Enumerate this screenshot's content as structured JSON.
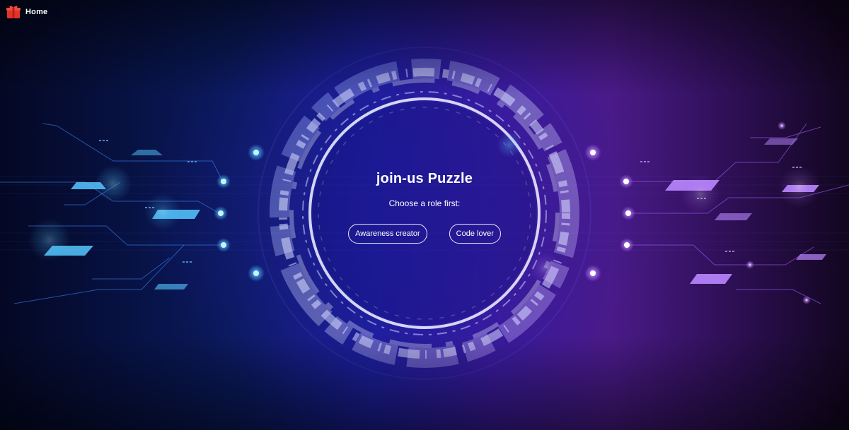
{
  "nav": {
    "home_label": "Home",
    "logo_icon": "gift-box-icon",
    "logo_color": "#e0332b"
  },
  "main": {
    "title": "join-us Puzzle",
    "subtitle": "Choose a role first:",
    "roles": [
      {
        "label": "Awareness creator"
      },
      {
        "label": "Code lover"
      }
    ]
  },
  "theme": {
    "left_accent": "#4fc3ff",
    "right_accent": "#b56cff",
    "ring_color": "#cfd3ff"
  }
}
